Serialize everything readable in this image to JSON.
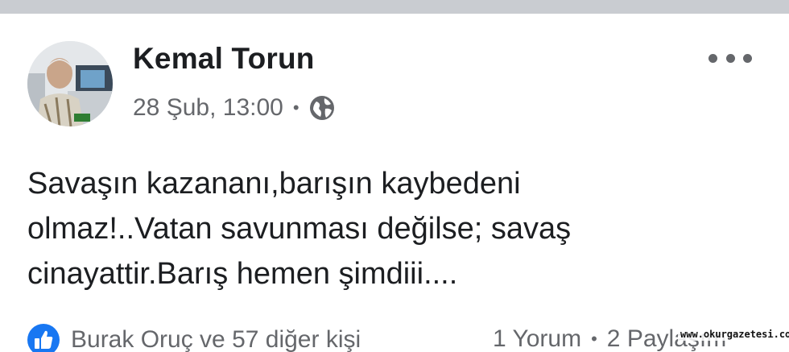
{
  "post": {
    "author": "Kemal Torun",
    "timestamp": "28 Şub, 13:00",
    "meta_separator": "•",
    "privacy_icon": "globe-icon",
    "more_icon": "more-options-icon",
    "text_lines": [
      "Savaşın kazananı,barışın kaybedeni",
      "olmaz!..Vatan savunması değilse; savaş",
      "cinayattir.Barış hemen şimdiii...."
    ]
  },
  "footer": {
    "reaction_icon": "like-icon",
    "reactions_text": "Burak Oruç ve 57 diğer kişi",
    "comments": "1 Yorum",
    "separator": "•",
    "shares": "2 Paylaşım"
  },
  "watermark": "www.okurgazetesi.com",
  "colors": {
    "primary_text": "#1c1e21",
    "secondary_text": "#65676b",
    "like_blue": "#1877f2",
    "top_strip": "#c9ccd1"
  }
}
